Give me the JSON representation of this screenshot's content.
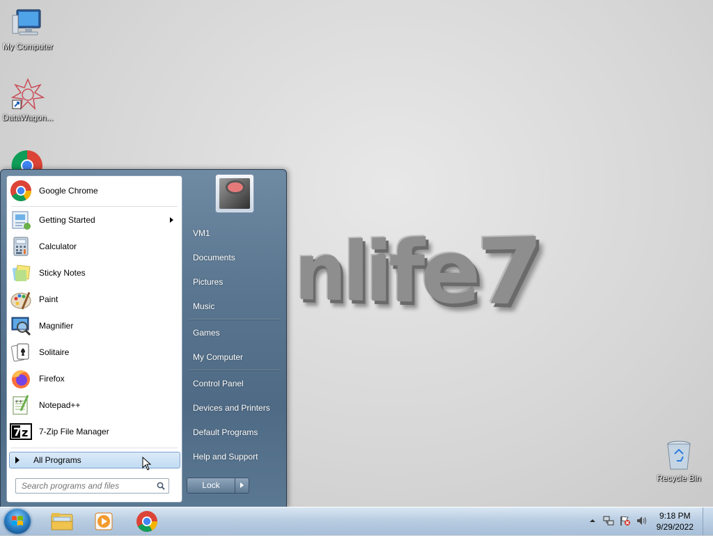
{
  "desktop": {
    "wallpaper_text": "nlife7",
    "icons": [
      {
        "label": "My Computer"
      },
      {
        "label": "DataWagon..."
      },
      {
        "label": "Recycle Bin"
      }
    ]
  },
  "start_menu": {
    "programs": [
      {
        "label": "Google Chrome",
        "icon": "chrome-icon"
      },
      {
        "label": "Getting Started",
        "icon": "getting-started-icon",
        "has_submenu": true
      },
      {
        "label": "Calculator",
        "icon": "calculator-icon"
      },
      {
        "label": "Sticky Notes",
        "icon": "sticky-notes-icon"
      },
      {
        "label": "Paint",
        "icon": "paint-icon"
      },
      {
        "label": "Magnifier",
        "icon": "magnifier-icon"
      },
      {
        "label": "Solitaire",
        "icon": "solitaire-icon"
      },
      {
        "label": "Firefox",
        "icon": "firefox-icon"
      },
      {
        "label": "Notepad++",
        "icon": "notepadpp-icon"
      },
      {
        "label": "7-Zip File Manager",
        "icon": "7zip-icon"
      }
    ],
    "all_programs_label": "All Programs",
    "search_placeholder": "Search programs and files",
    "right_items": [
      {
        "label": "VM1"
      },
      {
        "label": "Documents"
      },
      {
        "label": "Pictures"
      },
      {
        "label": "Music"
      },
      {
        "label": "Games"
      },
      {
        "label": "My Computer"
      },
      {
        "label": "Control Panel"
      },
      {
        "label": "Devices and Printers"
      },
      {
        "label": "Default Programs"
      },
      {
        "label": "Help and Support"
      }
    ],
    "lock_label": "Lock"
  },
  "taskbar": {
    "pinned": [
      "explorer-icon",
      "media-player-icon",
      "chrome-icon"
    ],
    "clock_time": "9:18 PM",
    "clock_date": "9/29/2022"
  },
  "colors": {
    "start_menu_blue": "#5a7690",
    "taskbar_blue": "#b9cde2",
    "highlight": "#c2dcf3"
  }
}
